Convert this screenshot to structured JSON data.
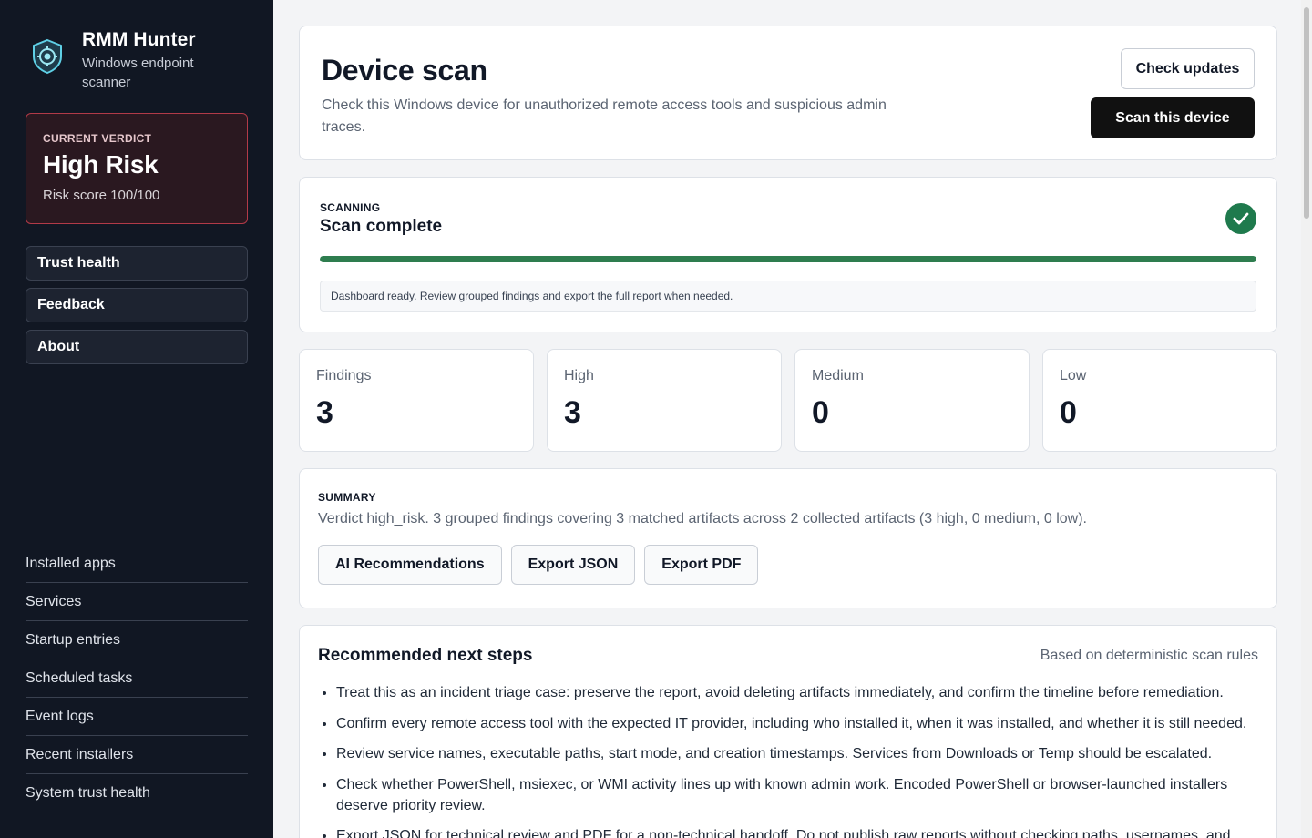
{
  "sidebar": {
    "brand_title": "RMM Hunter",
    "brand_subtitle": "Windows endpoint scanner",
    "verdict": {
      "label": "CURRENT VERDICT",
      "value": "High Risk",
      "score": "Risk score 100/100"
    },
    "nav": [
      "Trust health",
      "Feedback",
      "About"
    ],
    "links": [
      "Installed apps",
      "Services",
      "Startup entries",
      "Scheduled tasks",
      "Event logs",
      "Recent installers",
      "System trust health"
    ]
  },
  "header": {
    "title": "Device scan",
    "description": "Check this Windows device for unauthorized remote access tools and suspicious admin traces.",
    "check_updates": "Check updates",
    "scan_button": "Scan this device"
  },
  "scan": {
    "label": "SCANNING",
    "status": "Scan complete",
    "progress": 1.0,
    "message": "Dashboard ready. Review grouped findings and export the full report when needed."
  },
  "stats": [
    {
      "label": "Findings",
      "value": "3"
    },
    {
      "label": "High",
      "value": "3"
    },
    {
      "label": "Medium",
      "value": "0"
    },
    {
      "label": "Low",
      "value": "0"
    }
  ],
  "summary": {
    "label": "SUMMARY",
    "text": "Verdict high_risk. 3 grouped findings covering 3 matched artifacts across 2 collected artifacts (3 high, 0 medium, 0 low).",
    "actions": [
      "AI Recommendations",
      "Export JSON",
      "Export PDF"
    ]
  },
  "steps": {
    "title": "Recommended next steps",
    "meta": "Based on deterministic scan rules",
    "items": [
      "Treat this as an incident triage case: preserve the report, avoid deleting artifacts immediately, and confirm the timeline before remediation.",
      "Confirm every remote access tool with the expected IT provider, including who installed it, when it was installed, and whether it is still needed.",
      "Review service names, executable paths, start mode, and creation timestamps. Services from Downloads or Temp should be escalated.",
      "Check whether PowerShell, msiexec, or WMI activity lines up with known admin work. Encoded PowerShell or browser-launched installers deserve priority review.",
      "Export JSON for technical review and PDF for a non-technical handoff. Do not publish raw reports without checking paths, usernames, and"
    ]
  },
  "colors": {
    "sidebar_bg": "#111723",
    "verdict_border": "#b23a48",
    "success": "#1f7a4d",
    "primary_button": "#111111"
  },
  "icons": {
    "brand": "shield-logo-icon",
    "scan_done": "check-circle-icon"
  }
}
